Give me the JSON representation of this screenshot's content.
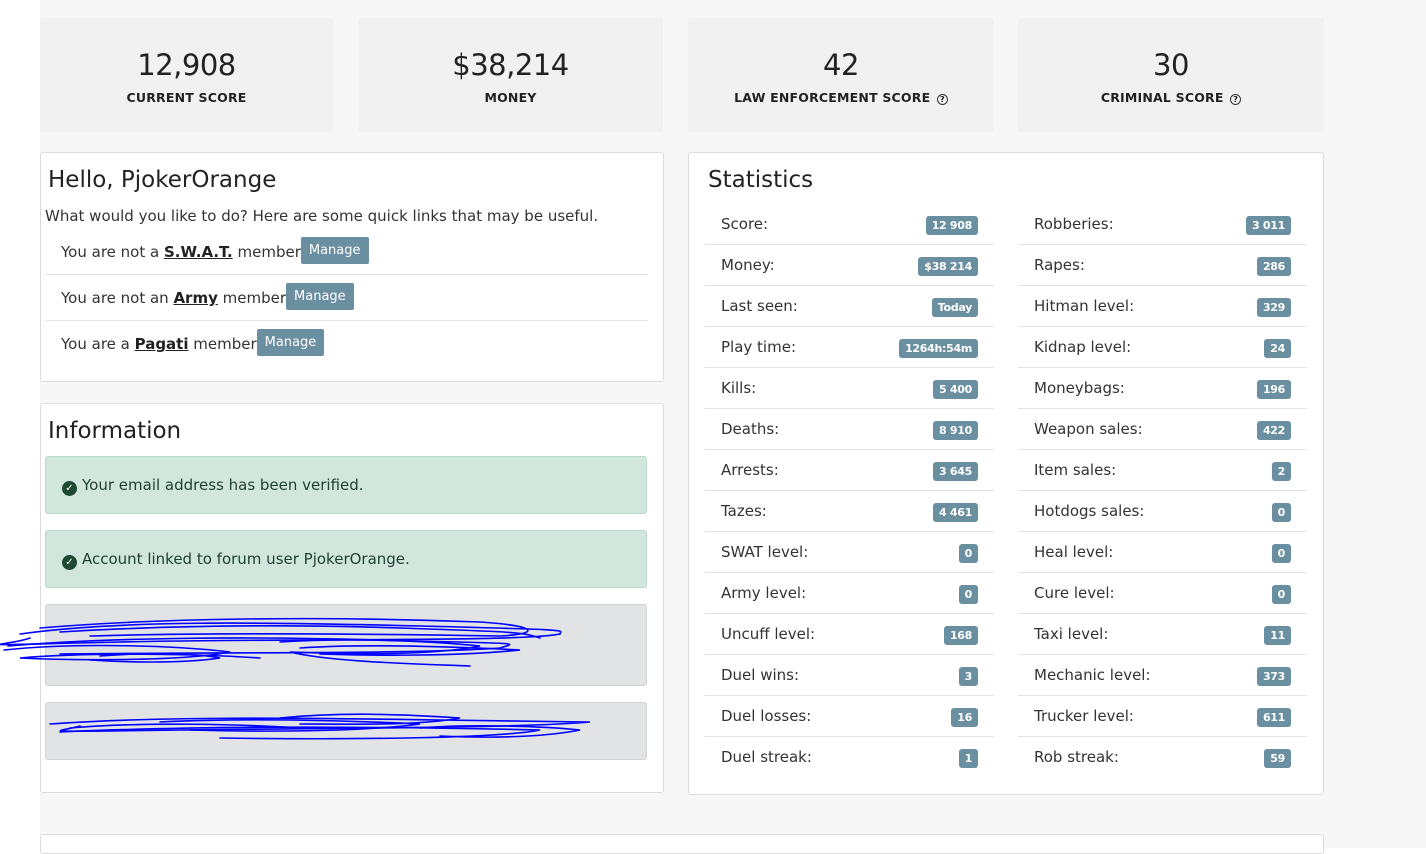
{
  "summary": [
    {
      "value": "12,908",
      "label": "CURRENT SCORE",
      "help": false
    },
    {
      "value": "$38,214",
      "label": "MONEY",
      "help": false
    },
    {
      "value": "42",
      "label": "LAW ENFORCEMENT SCORE",
      "help": true
    },
    {
      "value": "30",
      "label": "CRIMINAL SCORE",
      "help": true
    }
  ],
  "hello": {
    "title": "Hello, PjokerOrange",
    "subtitle": "What would you like to do? Here are some quick links that may be useful.",
    "memberships": [
      {
        "prefix": "You are not a ",
        "group": "S.W.A.T.",
        "suffix": " member",
        "button": "Manage"
      },
      {
        "prefix": "You are not an ",
        "group": "Army",
        "suffix": " member",
        "button": "Manage"
      },
      {
        "prefix": "You are a ",
        "group": "Pagati",
        "suffix": " member",
        "button": "Manage"
      }
    ]
  },
  "information": {
    "title": "Information",
    "alerts": [
      {
        "text": "Your email address has been verified."
      },
      {
        "text": "Account linked to forum user PjokerOrange."
      }
    ]
  },
  "statistics": {
    "title": "Statistics",
    "left": [
      {
        "label": "Score:",
        "value": "12 908"
      },
      {
        "label": "Money:",
        "value": "$38 214"
      },
      {
        "label": "Last seen:",
        "value": "Today"
      },
      {
        "label": "Play time:",
        "value": "1264h:54m"
      },
      {
        "label": "Kills:",
        "value": "5 400"
      },
      {
        "label": "Deaths:",
        "value": "8 910"
      },
      {
        "label": "Arrests:",
        "value": "3 645"
      },
      {
        "label": "Tazes:",
        "value": "4 461"
      },
      {
        "label": "SWAT level:",
        "value": "0"
      },
      {
        "label": "Army level:",
        "value": "0"
      },
      {
        "label": "Uncuff level:",
        "value": "168"
      },
      {
        "label": "Duel wins:",
        "value": "3"
      },
      {
        "label": "Duel losses:",
        "value": "16"
      },
      {
        "label": "Duel streak:",
        "value": "1"
      }
    ],
    "right": [
      {
        "label": "Robberies:",
        "value": "3 011"
      },
      {
        "label": "Rapes:",
        "value": "286"
      },
      {
        "label": "Hitman level:",
        "value": "329"
      },
      {
        "label": "Kidnap level:",
        "value": "24"
      },
      {
        "label": "Moneybags:",
        "value": "196"
      },
      {
        "label": "Weapon sales:",
        "value": "422"
      },
      {
        "label": "Item sales:",
        "value": "2"
      },
      {
        "label": "Hotdogs sales:",
        "value": "0"
      },
      {
        "label": "Heal level:",
        "value": "0"
      },
      {
        "label": "Cure level:",
        "value": "0"
      },
      {
        "label": "Taxi level:",
        "value": "11"
      },
      {
        "label": "Mechanic level:",
        "value": "373"
      },
      {
        "label": "Trucker level:",
        "value": "611"
      },
      {
        "label": "Rob streak:",
        "value": "59"
      }
    ]
  },
  "colors": {
    "badge": "#6a8fa0",
    "success_bg": "#d1e7dd",
    "muted_bg": "#e2e3e5",
    "scribble": "#0000ff"
  }
}
